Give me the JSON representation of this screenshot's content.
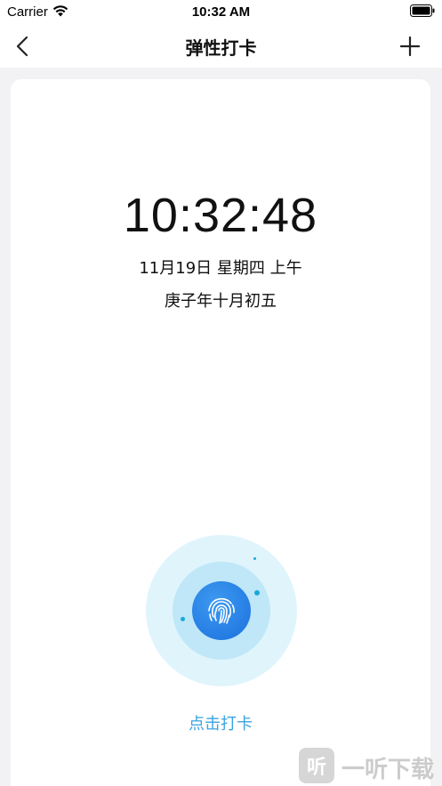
{
  "status_bar": {
    "carrier": "Carrier",
    "time": "10:32 AM",
    "icons": [
      "wifi-icon",
      "battery-icon"
    ]
  },
  "nav": {
    "title": "弹性打卡",
    "back_icon": "chevron-left-icon",
    "add_icon": "plus-icon"
  },
  "clock": {
    "time": "10:32:48",
    "date": "11月19日 星期四 上午",
    "lunar": "庚子年十月初五"
  },
  "punch": {
    "icon": "fingerprint-icon",
    "label": "点击打卡",
    "colors": {
      "outer": "#e0f4fc",
      "mid": "#bfe7f8",
      "button": "#1b70de",
      "label": "#3aa3e0"
    }
  },
  "watermark": {
    "badge": "听",
    "text": "一听下载"
  }
}
